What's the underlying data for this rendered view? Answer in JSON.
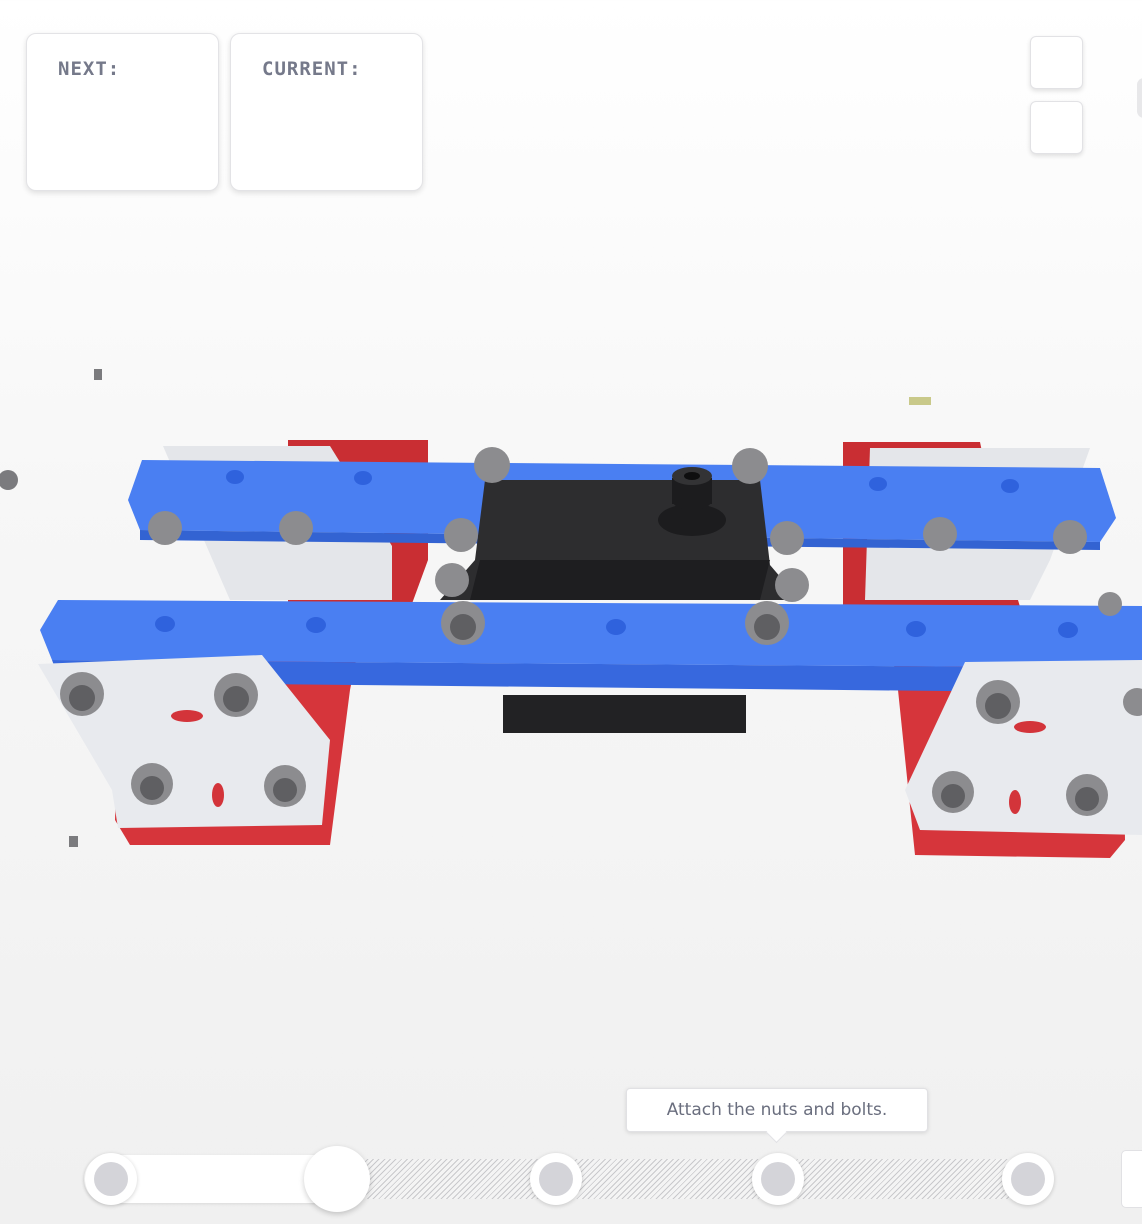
{
  "panels": {
    "next_label": "NEXT:",
    "current_label": "CURRENT:"
  },
  "view_controls": {
    "button_1_icon": "view-icon",
    "button_2_icon": "view-icon"
  },
  "model": {
    "name_icon": "robot-assembly-model",
    "colors": {
      "beam": "#4b7ef0",
      "frame": "#d8343a",
      "plate": "#e6e8ec",
      "servo": "#2e2e30",
      "bolt": "#8d8d90"
    }
  },
  "timeline": {
    "tooltip": "Attach the nuts and bolts.",
    "progress_fraction": 0.25,
    "steps_total": 5,
    "current_step": 2
  }
}
